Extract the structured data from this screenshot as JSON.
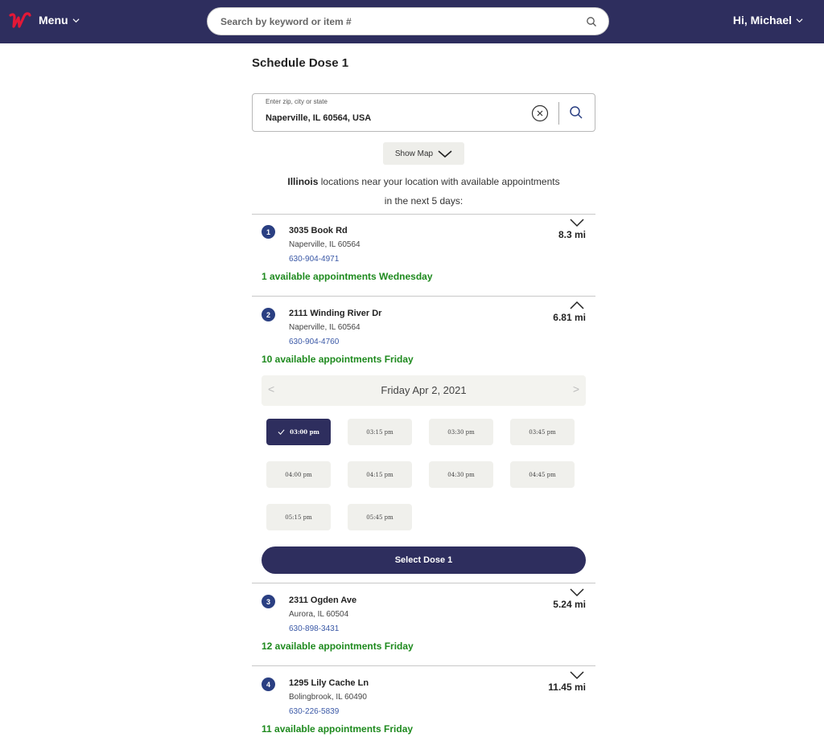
{
  "header": {
    "menu_label": "Menu",
    "search_placeholder": "Search by keyword or item #",
    "user_label": "Hi, Michael"
  },
  "page": {
    "title": "Schedule Dose 1"
  },
  "location_search": {
    "label": "Enter zip, city or state",
    "value": "Naperville, IL 60564, USA"
  },
  "show_map_label": "Show Map",
  "intro": {
    "state": "Illinois",
    "text_line1": " locations near your location with available appointments",
    "text_line2": "in the next 5 days:"
  },
  "locations": [
    {
      "num": "1",
      "address": "3035 Book Rd",
      "city": "Naperville, IL 60564",
      "phone": "630-904-4971",
      "availability": "1 available appointments Wednesday",
      "distance": "8.3 mi"
    },
    {
      "num": "2",
      "address": "2111 Winding River Dr",
      "city": "Naperville, IL 60564",
      "phone": "630-904-4760",
      "availability": "10 available appointments Friday",
      "distance": "6.81 mi"
    },
    {
      "num": "3",
      "address": "2311 Ogden Ave",
      "city": "Aurora, IL 60504",
      "phone": "630-898-3431",
      "availability": "12 available appointments Friday",
      "distance": "5.24 mi"
    },
    {
      "num": "4",
      "address": "1295 Lily Cache Ln",
      "city": "Bolingbrook, IL 60490",
      "phone": "630-226-5839",
      "availability": "11 available appointments Friday",
      "distance": "11.45 mi"
    }
  ],
  "schedule": {
    "date": "Friday Apr 2, 2021",
    "prev_glyph": "<",
    "next_glyph": ">",
    "slots": [
      "03:00 pm",
      "03:15 pm",
      "03:30 pm",
      "03:45 pm",
      "04:00 pm",
      "04:15 pm",
      "04:30 pm",
      "04:45 pm",
      "05:15 pm",
      "05:45 pm"
    ],
    "select_label": "Select Dose 1"
  },
  "colors": {
    "header": "#2e2e5e",
    "logo": "#e31837",
    "availability": "#1e8a1e",
    "badge": "#2a3f82",
    "link": "#3a58a6"
  }
}
